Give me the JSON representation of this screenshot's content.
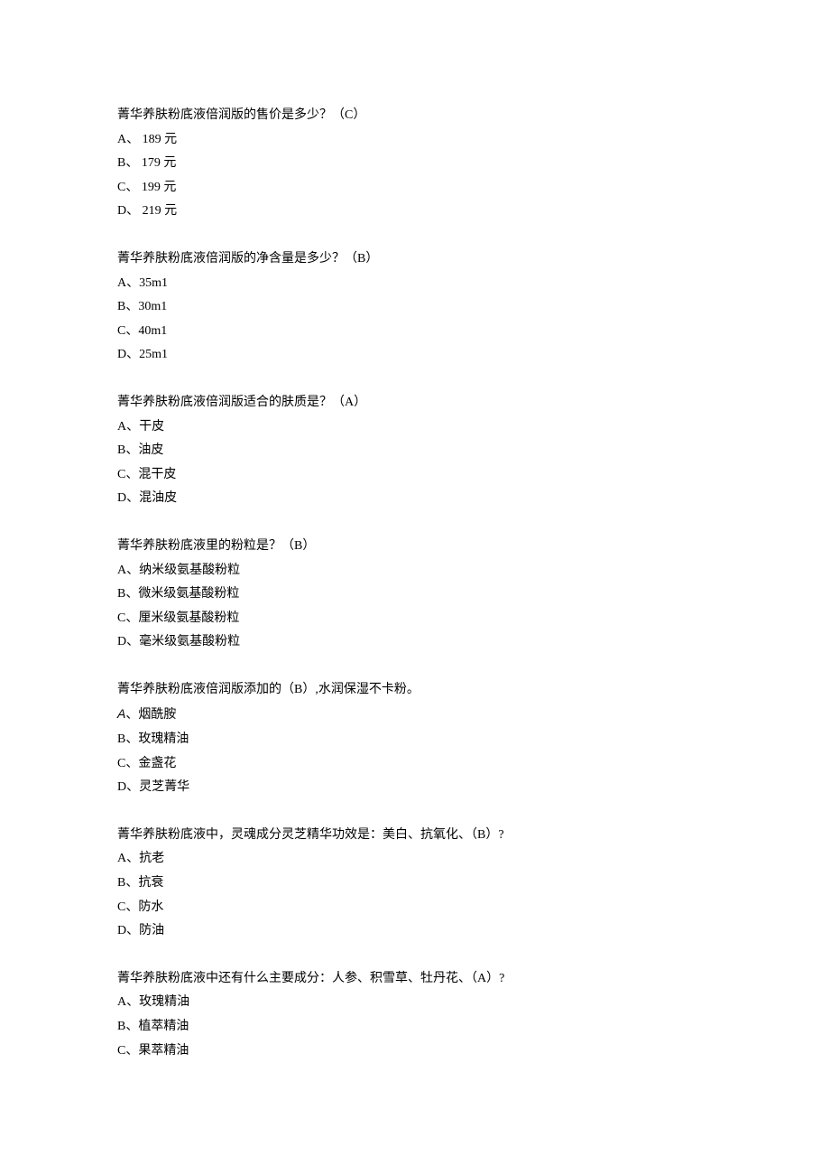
{
  "questions": [
    {
      "text": "菁华养肤粉底液倍润版的售价是多少？（C）",
      "options": [
        "A、 189 元",
        "B、 179 元",
        "C、 199 元",
        "D、 219 元"
      ]
    },
    {
      "text": "菁华养肤粉底液倍润版的净含量是多少？（B）",
      "options": [
        "A、35m1",
        "B、30m1",
        "C、40m1",
        "D、25m1"
      ]
    },
    {
      "text": "菁华养肤粉底液倍润版适合的肤质是？（A）",
      "options": [
        "A、干皮",
        "B、油皮",
        "C、混干皮",
        "D、混油皮"
      ]
    },
    {
      "text": "菁华养肤粉底液里的粉粒是？（B）",
      "options": [
        "A、纳米级氨基酸粉粒",
        "B、微米级氨基酸粉粒",
        "C、厘米级氨基酸粉粒",
        "D、毫米级氨基酸粉粒"
      ]
    },
    {
      "text": "菁华养肤粉底液倍润版添加的（B）,水润保湿不卡粉。",
      "options": [
        "A、烟酰胺",
        "B、玫瑰精油",
        "C、金盏花",
        "D、灵芝菁华"
      ],
      "italicFirst": true
    },
    {
      "text": "菁华养肤粉底液中，灵魂成分灵芝精华功效是：美白、抗氧化、（B）?",
      "options": [
        "A、抗老",
        "B、抗衰",
        "C、防水",
        "D、防油"
      ]
    },
    {
      "text": "菁华养肤粉底液中还有什么主要成分：人参、积雪草、牡丹花、（A）?",
      "options": [
        "A、玫瑰精油",
        "B、植萃精油",
        "C、果萃精油"
      ]
    }
  ]
}
